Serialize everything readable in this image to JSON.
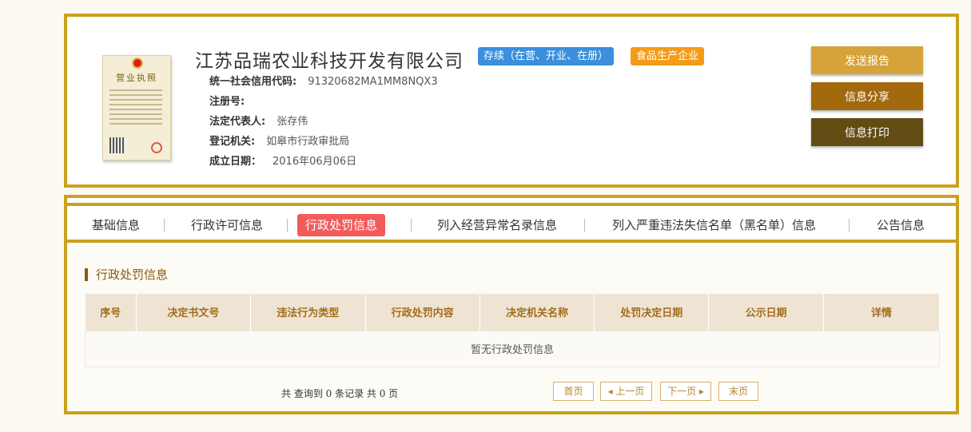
{
  "company": {
    "name": "江苏品瑞农业科技开发有限公司",
    "status_tag": "存续（在营、开业、在册）",
    "type_tag": "食品生产企业",
    "license_title": "营业执照",
    "colors": {
      "status_tag": "#3b8fdc",
      "type_tag": "#f49c18"
    }
  },
  "info": [
    {
      "label": "统一社会信用代码:",
      "value": "91320682MA1MM8NQX3"
    },
    {
      "label": "注册号:",
      "value": ""
    },
    {
      "label": "法定代表人:",
      "value": "张存伟"
    },
    {
      "label": "登记机关:",
      "value": "如皋市行政审批局"
    },
    {
      "label": "成立日期：",
      "value": "2016年06月06日"
    }
  ],
  "actions": {
    "report": "发送报告",
    "share": "信息分享",
    "print": "信息打印"
  },
  "tabs": [
    {
      "label": "基础信息"
    },
    {
      "label": "行政许可信息"
    },
    {
      "label": "行政处罚信息",
      "active": true
    },
    {
      "label": "列入经营异常名录信息"
    },
    {
      "label": "列入严重违法失信名单（黑名单）信息"
    },
    {
      "label": "公告信息"
    }
  ],
  "section": {
    "title": "行政处罚信息",
    "columns": [
      "序号",
      "决定书文号",
      "违法行为类型",
      "行政处罚内容",
      "决定机关名称",
      "处罚决定日期",
      "公示日期",
      "详情"
    ],
    "empty_message": "暂无行政处罚信息"
  },
  "pagination": {
    "summary": "共 查询到 0 条记录 共 0 页",
    "first": "首页",
    "prev": "◂ 上一页",
    "next": "下一页 ▸",
    "last": "末页"
  }
}
